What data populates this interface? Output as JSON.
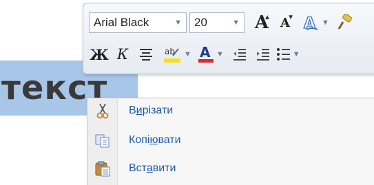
{
  "document": {
    "selected_text": "текст"
  },
  "mini_toolbar": {
    "font_name": "Arial Black",
    "font_size": "20",
    "row1_icons": [
      "grow-font-icon",
      "shrink-font-icon",
      "text-effects-icon",
      "format-painter-icon"
    ],
    "bold_label": "Ж",
    "italic_label": "К",
    "row2_icons": [
      "align-center-icon",
      "highlight-color-icon",
      "font-color-icon",
      "decrease-indent-icon",
      "increase-indent-icon",
      "bullets-icon"
    ],
    "highlight_label": "ab",
    "font_color_label": "A",
    "highlight_color": "#f5e020",
    "font_color": "#d42a2a"
  },
  "context_menu": {
    "items": [
      {
        "label_pre": "В",
        "label_hot": "и",
        "label_post": "різати",
        "icon": "scissors-icon"
      },
      {
        "label_pre": "Копі",
        "label_hot": "ю",
        "label_post": "вати",
        "icon": "copy-icon"
      },
      {
        "label_pre": "Вст",
        "label_hot": "а",
        "label_post": "вити",
        "icon": "paste-icon"
      }
    ]
  }
}
